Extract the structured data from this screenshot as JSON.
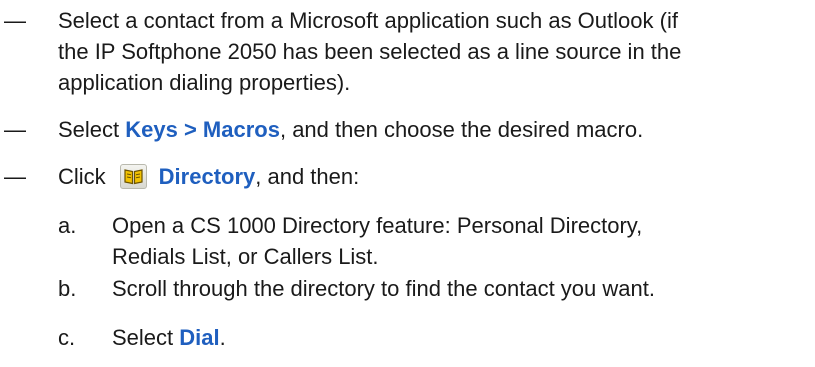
{
  "bullets": [
    {
      "dash": "—",
      "lines": [
        "Select a contact from a Microsoft application such as Outlook (if",
        "the IP Softphone 2050 has been selected as a line source in the",
        "application dialing properties)."
      ]
    },
    {
      "dash": "—",
      "prefix": "Select ",
      "keyword": "Keys > Macros",
      "suffix": ", and then choose the desired macro."
    },
    {
      "dash": "—",
      "prefix": "Click",
      "icon": "directory-book-icon",
      "keyword": "Directory",
      "suffix": ", and then:"
    }
  ],
  "steps": [
    {
      "letter": "a.",
      "lines": [
        "Open a CS 1000 Directory feature: Personal Directory,",
        "Redials List, or Callers List."
      ]
    },
    {
      "letter": "b.",
      "lines": [
        "Scroll through the directory to find the contact you want."
      ]
    },
    {
      "letter": "c.",
      "prefix": "Select ",
      "keyword": "Dial",
      "suffix": "."
    }
  ],
  "colors": {
    "keyword": "#1f5fbf",
    "text": "#1a1a1a",
    "icon_accent": "#c8a000"
  }
}
